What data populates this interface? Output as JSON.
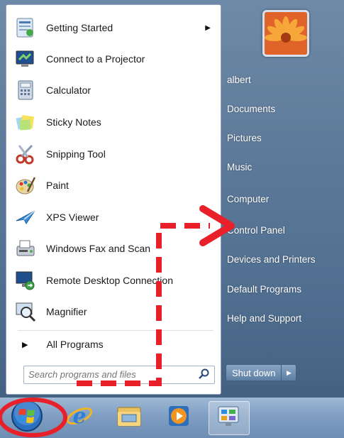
{
  "start_menu": {
    "programs": [
      {
        "label": "Getting Started",
        "icon": "getting-started-icon",
        "has_submenu": true
      },
      {
        "label": "Connect to a Projector",
        "icon": "projector-icon",
        "has_submenu": false
      },
      {
        "label": "Calculator",
        "icon": "calculator-icon",
        "has_submenu": false
      },
      {
        "label": "Sticky Notes",
        "icon": "sticky-notes-icon",
        "has_submenu": false
      },
      {
        "label": "Snipping Tool",
        "icon": "scissors-icon",
        "has_submenu": false
      },
      {
        "label": "Paint",
        "icon": "paint-palette-icon",
        "has_submenu": false
      },
      {
        "label": "XPS Viewer",
        "icon": "xps-viewer-icon",
        "has_submenu": false
      },
      {
        "label": "Windows Fax and Scan",
        "icon": "fax-scanner-icon",
        "has_submenu": false
      },
      {
        "label": "Remote Desktop Connection",
        "icon": "remote-desktop-icon",
        "has_submenu": false
      },
      {
        "label": "Magnifier",
        "icon": "magnifier-icon",
        "has_submenu": false
      }
    ],
    "all_programs_label": "All Programs",
    "search_placeholder": "Search programs and files",
    "right_items": [
      {
        "label": "albert"
      },
      {
        "label": "Documents"
      },
      {
        "label": "Pictures"
      },
      {
        "label": "Music"
      },
      {
        "label": "Computer"
      },
      {
        "label": "Control Panel"
      },
      {
        "label": "Devices and Printers"
      },
      {
        "label": "Default Programs"
      },
      {
        "label": "Help and Support"
      }
    ],
    "shutdown_label": "Shut down"
  },
  "taskbar": {
    "items": [
      {
        "icon": "windows-start-orb-icon"
      },
      {
        "icon": "internet-explorer-icon"
      },
      {
        "icon": "file-explorer-folder-icon"
      },
      {
        "icon": "media-player-icon"
      },
      {
        "icon": "control-panel-icon"
      }
    ]
  },
  "annotations": {
    "highlight_color": "#e8202a"
  }
}
